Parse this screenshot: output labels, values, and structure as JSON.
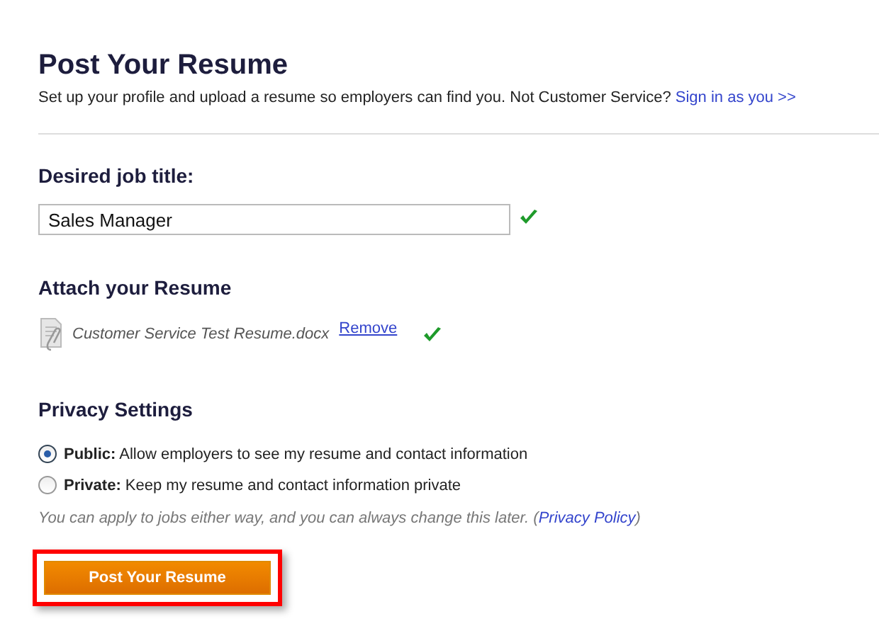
{
  "title": "Post Your Resume",
  "subtitle": {
    "text": "Set up your profile and upload a resume so employers can find you. Not Customer Service?",
    "link": "Sign in as you >>"
  },
  "job_title": {
    "label": "Desired job title:",
    "value": "Sales Manager",
    "valid": true
  },
  "attach": {
    "heading": "Attach your Resume",
    "file_name": "Customer Service Test Resume.docx",
    "remove_link": "Remove",
    "valid": true
  },
  "privacy": {
    "heading": "Privacy Settings",
    "options": [
      {
        "label": "**Public:** Allow employers to see my resume and contact information",
        "selected": true
      },
      {
        "label": "**Private:** Keep my resume and contact information private",
        "selected": false
      }
    ],
    "note": "You can apply to jobs either way, and you can always change this later. (",
    "policy_link": "Privacy Policy",
    "note_end": ")"
  },
  "submit": {
    "label": "Post Your Resume",
    "highlighted": true
  }
}
